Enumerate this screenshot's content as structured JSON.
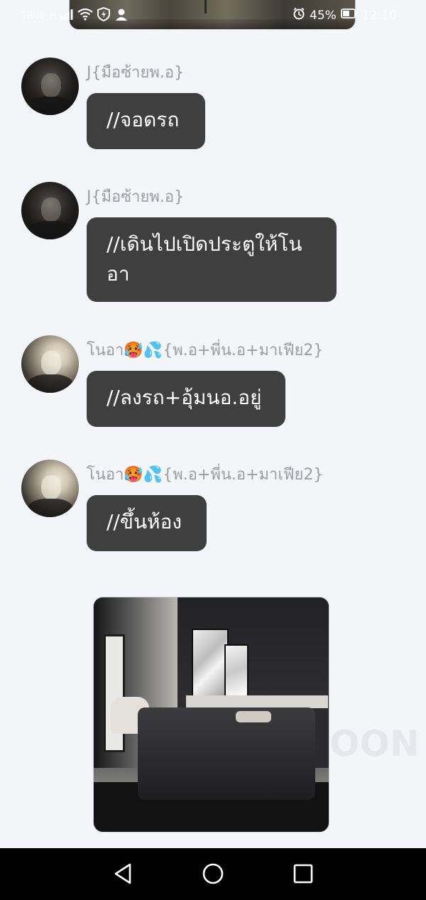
{
  "status_bar": {
    "carrier": "TRUE-H",
    "battery": "45%",
    "time": "12:10"
  },
  "messages": [
    {
      "sender": "J{มือซ้ายพ.อ}",
      "text": "//จอดรถ",
      "avatar": "dark"
    },
    {
      "sender": "J{มือซ้ายพ.อ}",
      "text_line1": "//เดินไปเปิดประตูให้โน",
      "text_line2": "อา",
      "avatar": "dark"
    },
    {
      "sender": "โนอา🥵💦{พ.อ+พี่น.อ+มาเฟีย2}",
      "text": "//ลงรถ+อุ้มนอ.อยู่",
      "avatar": "light"
    },
    {
      "sender": "โนอา🥵💦{พ.อ+พี่น.อ+มาเฟีย2}",
      "text": "//ขึ้นห้อง",
      "avatar": "light"
    }
  ],
  "watermark": "OON",
  "icons": {
    "signal": "signal-icon",
    "wifi": "wifi-icon",
    "shield": "shield-icon",
    "alarm": "alarm-icon",
    "battery": "battery-icon",
    "back": "back-triangle-icon",
    "home": "home-circle-icon",
    "recents": "recents-square-icon"
  },
  "colors": {
    "background": "#f4f5f9",
    "bubble": "#3f3f3f",
    "bubble_text": "#ffffff",
    "sender_text": "#9a9da3",
    "nav_bar": "#000000"
  }
}
